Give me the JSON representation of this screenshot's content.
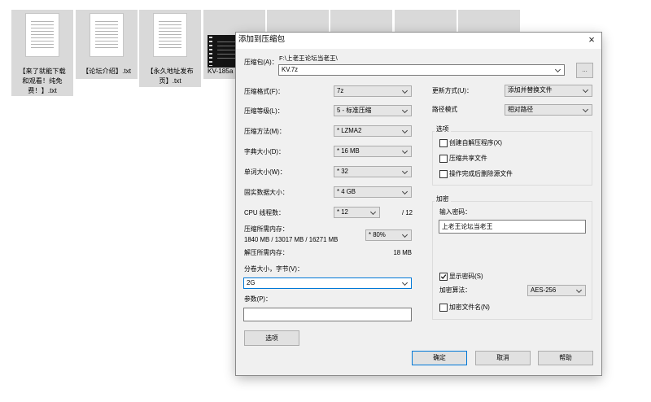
{
  "files": [
    {
      "icon": "text-file-icon",
      "lines": [
        "【来了就能下载",
        "和观看！纯免",
        "费！】.txt"
      ]
    },
    {
      "icon": "text-file-icon",
      "lines": [
        "【论坛介绍】.txt"
      ]
    },
    {
      "icon": "text-file-icon",
      "lines": [
        "【永久地址发布",
        "页】.txt"
      ]
    },
    {
      "icon": "video-thumbnail-icon",
      "lines": [
        "KV-185a"
      ]
    }
  ],
  "dialog": {
    "title": "添加到压缩包",
    "close_glyph": "×",
    "archive": {
      "label": "压缩包(A)：",
      "folder": "F:\\上老王论坛当老王\\",
      "name": "KV.7z",
      "browse": "..."
    },
    "format": {
      "label": "压缩格式(F)：",
      "value": "7z"
    },
    "level": {
      "label": "压缩等级(L)：",
      "value": "5 - 标准压缩"
    },
    "method": {
      "label": "压缩方法(M)：",
      "value": "* LZMA2"
    },
    "dictionary": {
      "label": "字典大小(D)：",
      "value": "* 16 MB"
    },
    "word_size": {
      "label": "单词大小(W)：",
      "value": "* 32"
    },
    "solid_block": {
      "label": "固实数据大小：",
      "value": "* 4 GB"
    },
    "threads": {
      "label": "CPU 线程数：",
      "value": "* 12",
      "max": "/ 12"
    },
    "compress_memory": {
      "label": "压缩所需内存：",
      "detail": "1840 MB / 13017 MB / 16271 MB",
      "value": "* 80%"
    },
    "decompress_memory": {
      "label": "解压所需内存：",
      "value": "18 MB"
    },
    "volume": {
      "label": "分卷大小，字节(V)：",
      "value": "2G"
    },
    "params": {
      "label": "参数(P)："
    },
    "options_button": "选项",
    "update_mode": {
      "label": "更新方式(U)：",
      "value": "添加并替换文件"
    },
    "path_mode": {
      "label": "路径模式",
      "value": "相对路径"
    },
    "options_group": {
      "title": "选项",
      "items": [
        {
          "label": "创建自解压程序(X)",
          "checked": false
        },
        {
          "label": "压缩共享文件",
          "checked": false
        },
        {
          "label": "操作完成后删除源文件",
          "checked": false
        }
      ]
    },
    "encryption": {
      "title": "加密",
      "password_label": "输入密码：",
      "password": "上老王论坛当老王",
      "show_password": {
        "label": "显示密码(S)",
        "checked": true
      },
      "method_label": "加密算法：",
      "method": "AES-256",
      "encrypt_names": {
        "label": "加密文件名(N)",
        "checked": false
      }
    },
    "buttons": {
      "ok": "确定",
      "cancel": "取消",
      "help": "帮助"
    }
  }
}
